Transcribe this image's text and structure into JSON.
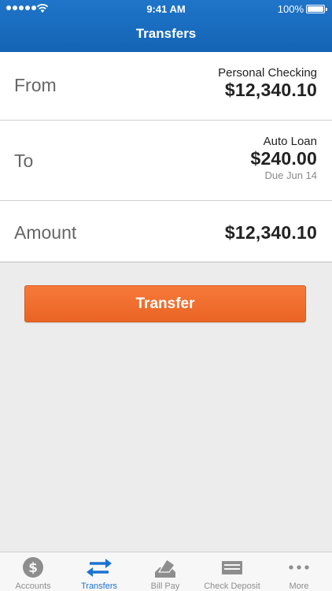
{
  "status_bar": {
    "time": "9:41 AM",
    "battery": "100%",
    "signal_icon": "signal-dots-icon",
    "wifi_icon": "wifi-icon"
  },
  "header": {
    "title": "Transfers"
  },
  "from": {
    "label": "From",
    "account": "Personal Checking",
    "amount": "$12,340.10"
  },
  "to": {
    "label": "To",
    "account": "Auto Loan",
    "amount": "$240.00",
    "due": "Due Jun 14"
  },
  "amount_row": {
    "label": "Amount",
    "value": "$12,340.10"
  },
  "transfer_button": {
    "label": "Transfer",
    "color": "#ef6b2c"
  },
  "tabbar": {
    "active_color": "#1b72d0",
    "inactive_color": "#8e8e8e",
    "tabs": [
      {
        "label": "Accounts",
        "icon": "dollar-circle-icon"
      },
      {
        "label": "Transfers",
        "icon": "transfer-arrows-icon"
      },
      {
        "label": "Bill Pay",
        "icon": "bill-pay-icon"
      },
      {
        "label": "Check Deposit",
        "icon": "check-icon"
      },
      {
        "label": "More",
        "icon": "more-dots-icon"
      }
    ]
  },
  "colors": {
    "header": "#1a6cc0",
    "background": "#ececec"
  }
}
